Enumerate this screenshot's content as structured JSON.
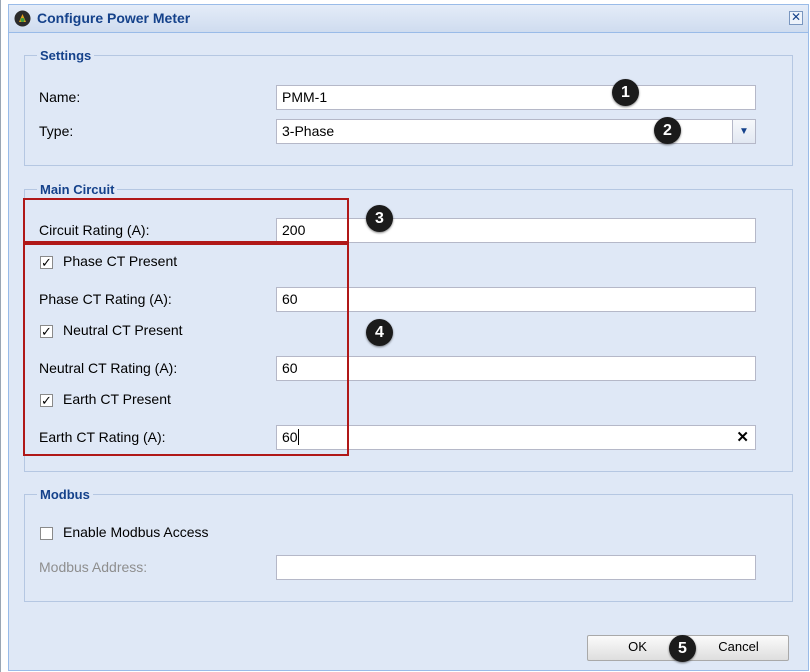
{
  "dialog": {
    "title": "Configure Power Meter"
  },
  "settings": {
    "legend": "Settings",
    "name_label": "Name:",
    "name_value": "PMM-1",
    "type_label": "Type:",
    "type_value": "3-Phase"
  },
  "main_circuit": {
    "legend": "Main Circuit",
    "circuit_rating_label": "Circuit Rating (A):",
    "circuit_rating_value": "200",
    "phase_ct_present_label": "Phase CT Present",
    "phase_ct_present_checked": true,
    "phase_ct_rating_label": "Phase CT Rating (A):",
    "phase_ct_rating_value": "60",
    "neutral_ct_present_label": "Neutral CT Present",
    "neutral_ct_present_checked": true,
    "neutral_ct_rating_label": "Neutral CT Rating (A):",
    "neutral_ct_rating_value": "60",
    "earth_ct_present_label": "Earth CT Present",
    "earth_ct_present_checked": true,
    "earth_ct_rating_label": "Earth CT Rating (A):",
    "earth_ct_rating_value": "60"
  },
  "modbus": {
    "legend": "Modbus",
    "enable_label": "Enable Modbus Access",
    "enable_checked": false,
    "address_label": "Modbus Address:",
    "address_value": ""
  },
  "buttons": {
    "ok": "OK",
    "cancel": "Cancel"
  },
  "markers": [
    "1",
    "2",
    "3",
    "4",
    "5"
  ],
  "icons": {
    "close": "close-icon",
    "dropdown": "chevron-down-icon",
    "clear": "clear-x-icon",
    "check": "checkmark-icon",
    "app": "power-meter-icon"
  },
  "colors": {
    "title_text": "#15428b",
    "dialog_bg": "#dfe8f6",
    "highlight": "#b01818"
  }
}
